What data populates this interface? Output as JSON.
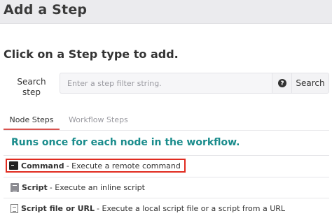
{
  "header": {
    "title": "Add a Step"
  },
  "subtitle": "Click on a Step type to add.",
  "search": {
    "label": "Search step",
    "placeholder": "Enter a step filter string.",
    "help_icon": "question-circle-icon",
    "button_label": "Search"
  },
  "tabs": [
    {
      "label": "Node Steps",
      "active": true
    },
    {
      "label": "Workflow Steps",
      "active": false
    }
  ],
  "section_heading": "Runs once for each node in the workflow.",
  "steps": [
    {
      "name": "Command",
      "description": "- Execute a remote command",
      "icon": "terminal-icon",
      "highlighted": true
    },
    {
      "name": "Script",
      "description": "- Execute an inline script",
      "icon": "script-icon",
      "highlighted": false
    },
    {
      "name": "Script file or URL",
      "description": "- Execute a local script file or a script from a URL",
      "icon": "file-icon",
      "highlighted": false
    }
  ],
  "colors": {
    "accent_teal": "#1a8c8c",
    "tab_active_underline": "#d9534f",
    "highlight_border": "#e02b20"
  }
}
